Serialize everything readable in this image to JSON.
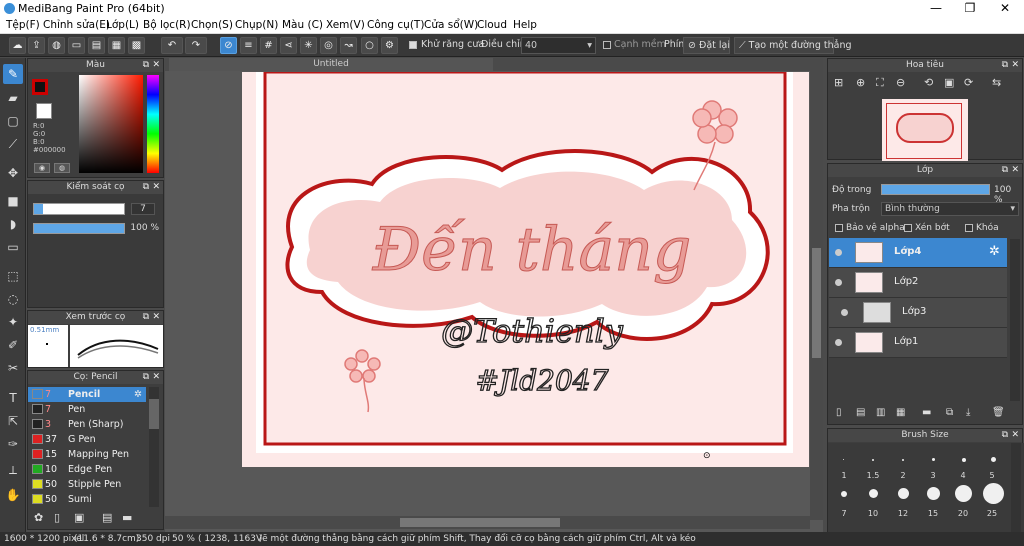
{
  "window": {
    "title": "MediBang Paint Pro (64bit)",
    "minimize": "—",
    "maximize": "❐",
    "close": "✕"
  },
  "menu": [
    "Tệp(F)",
    "Chỉnh sửa(E)",
    "Lớp(L)",
    "Bộ lọc(R)",
    "Chọn(S)",
    "Chụp(N)",
    "Màu (C)",
    "Xem(V)",
    "Công cụ(T)",
    "Cửa sổ(W)",
    "Cloud",
    "Help"
  ],
  "toolbar": {
    "antialias_label": "Khử răng cưa",
    "adjust_label": "Điều chỉnh",
    "adjust_value": "40",
    "edge_label": "Cạnh mềm",
    "key_label": "Phím",
    "reset_label": "Đặt lại",
    "straight_line_label": "Tạo một đường thẳng"
  },
  "color_panel": {
    "title": "Màu",
    "r": "R:0",
    "g": "G:0",
    "b": "B:0",
    "hex": "#000000",
    "main_color": "#cc0000"
  },
  "brush_control": {
    "title": "Kiểm soát cọ",
    "size": "7",
    "opacity": "100 %"
  },
  "brush_preview": {
    "title": "Xem trước cọ",
    "size_text": "0.51mm"
  },
  "brush_list": {
    "title": "Cọ: Pencil",
    "items": [
      {
        "size": "7",
        "name": "Pencil",
        "color": "#222222"
      },
      {
        "size": "7",
        "name": "Pen",
        "color": "#222222"
      },
      {
        "size": "3",
        "name": "Pen (Sharp)",
        "color": "#222222"
      },
      {
        "size": "37",
        "name": "G Pen",
        "color": "#dd2222"
      },
      {
        "size": "15",
        "name": "Mapping Pen",
        "color": "#dd2222"
      },
      {
        "size": "10",
        "name": "Edge Pen",
        "color": "#22aa22"
      },
      {
        "size": "50",
        "name": "Stipple Pen",
        "color": "#dddd22"
      },
      {
        "size": "50",
        "name": "Sumi",
        "color": "#dddd22"
      }
    ]
  },
  "canvas": {
    "tab_title": "Untitled",
    "artwork_text": "Đến tháng",
    "handle": "@Tothienly",
    "hashtag": "#Jld2047"
  },
  "navigator": {
    "title": "Hoa tiêu"
  },
  "layer_panel": {
    "title": "Lớp",
    "opacity_label": "Độ trong",
    "opacity_value": "100 %",
    "blend_label": "Pha trộn",
    "blend_value": "Bình thường",
    "protect_alpha": "Bảo vệ alpha",
    "clipping": "Xén bớt",
    "lock": "Khóa",
    "layers": [
      {
        "name": "Lớp4",
        "selected": true
      },
      {
        "name": "Lớp2",
        "selected": false
      },
      {
        "name": "Lớp3",
        "selected": false
      },
      {
        "name": "Lớp1",
        "selected": false
      }
    ]
  },
  "brush_size_panel": {
    "title": "Brush Size",
    "sizes_row1": [
      "1",
      "1.5",
      "2",
      "3",
      "4",
      "5"
    ],
    "sizes_row2": [
      "7",
      "10",
      "12",
      "15",
      "20",
      "25"
    ]
  },
  "status": {
    "dimensions": "1600 * 1200 pixel",
    "physical": "(11.6 * 8.7cm)",
    "dpi": "350 dpi",
    "zoom": "50 %",
    "coords": "( 1238, 1163 )",
    "hint": "Vẽ một đường thẳng bằng cách giữ phím Shift, Thay đổi cỡ cọ bằng cách giữ phím Ctrl, Alt và kéo"
  }
}
